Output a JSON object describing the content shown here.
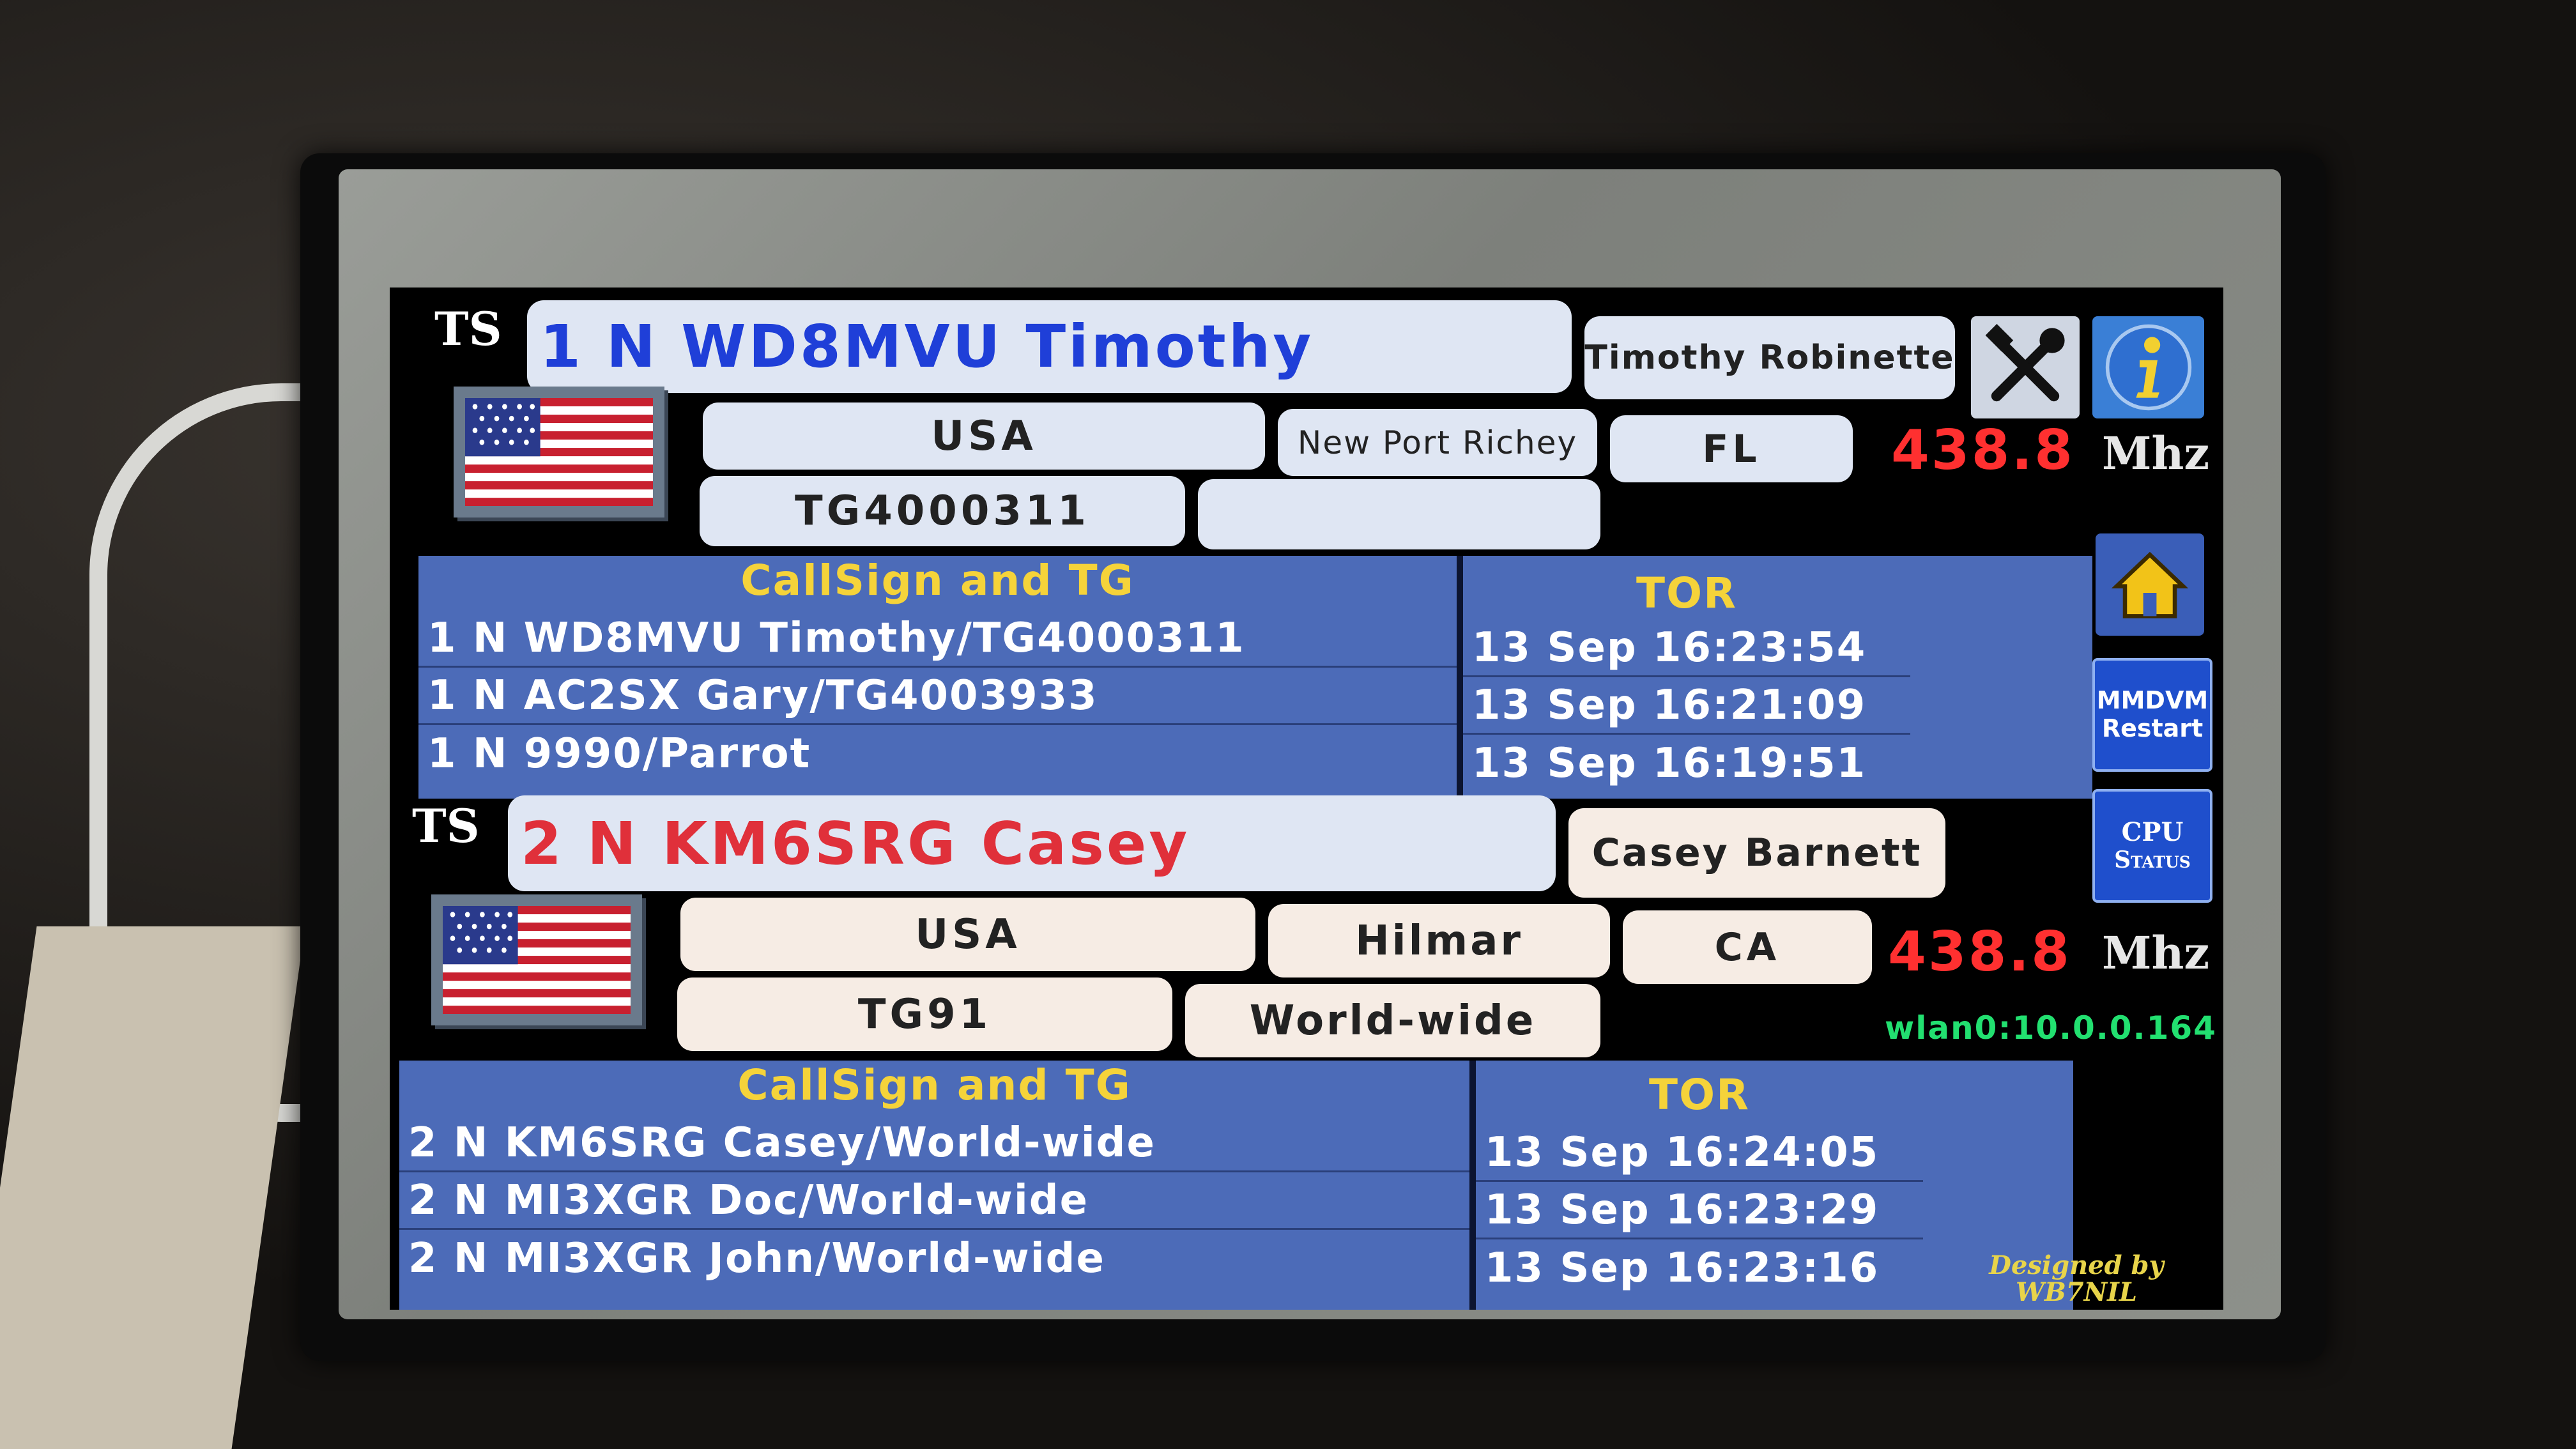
{
  "slot1": {
    "ts_label": "TS",
    "callsign_line": "1 N WD8MVU Timothy",
    "full_name": "Timothy Robinette",
    "country": "USA",
    "city": "New Port Richey",
    "state": "FL",
    "talkgroup": "TG4000311",
    "talkgroup_name": "",
    "frequency": "438.8",
    "unit": "Mhz",
    "name_color": "#1f3fd8",
    "history_header": "CallSign and TG",
    "tor_header": "TOR",
    "history": [
      {
        "entry": "1 N WD8MVU Timothy/TG4000311",
        "time": "13 Sep 16:23:54"
      },
      {
        "entry": "1 N AC2SX Gary/TG4003933",
        "time": "13 Sep 16:21:09"
      },
      {
        "entry": "1 N 9990/Parrot",
        "time": "13 Sep 16:19:51"
      }
    ]
  },
  "slot2": {
    "ts_label": "TS",
    "callsign_line": "2 N KM6SRG Casey",
    "full_name": "Casey Barnett",
    "country": "USA",
    "city": "Hilmar",
    "state": "CA",
    "talkgroup": "TG91",
    "talkgroup_name": "World-wide",
    "frequency": "438.8",
    "unit": "Mhz",
    "name_color": "#e0303a",
    "history_header": "CallSign and TG",
    "tor_header": "TOR",
    "history": [
      {
        "entry": "2 N KM6SRG Casey/World-wide",
        "time": "13 Sep 16:24:05"
      },
      {
        "entry": "2 N MI3XGR Doc/World-wide",
        "time": "13 Sep 16:23:29"
      },
      {
        "entry": "2 N MI3XGR John/World-wide",
        "time": "13 Sep 16:23:16"
      }
    ]
  },
  "sidebar": {
    "settings_icon": "tools-icon",
    "info_icon": "info-icon",
    "home_icon": "home-icon",
    "mmdvm_restart": {
      "line1": "MMDVM",
      "line2": "Restart"
    },
    "cpu_status": {
      "line1": "CPU",
      "line2": "Status"
    }
  },
  "network": "wlan0:10.0.0.164",
  "credit": {
    "line1": "Designed by",
    "line2": "WB7NIL"
  },
  "colors": {
    "pill": "#dfe6f3",
    "pill_cream": "#f6ece4",
    "table": "#4c6bb8",
    "table_header_text": "#f5d33a",
    "frequency": "#ff3030",
    "network": "#22e070",
    "credit": "#e8d44a"
  }
}
